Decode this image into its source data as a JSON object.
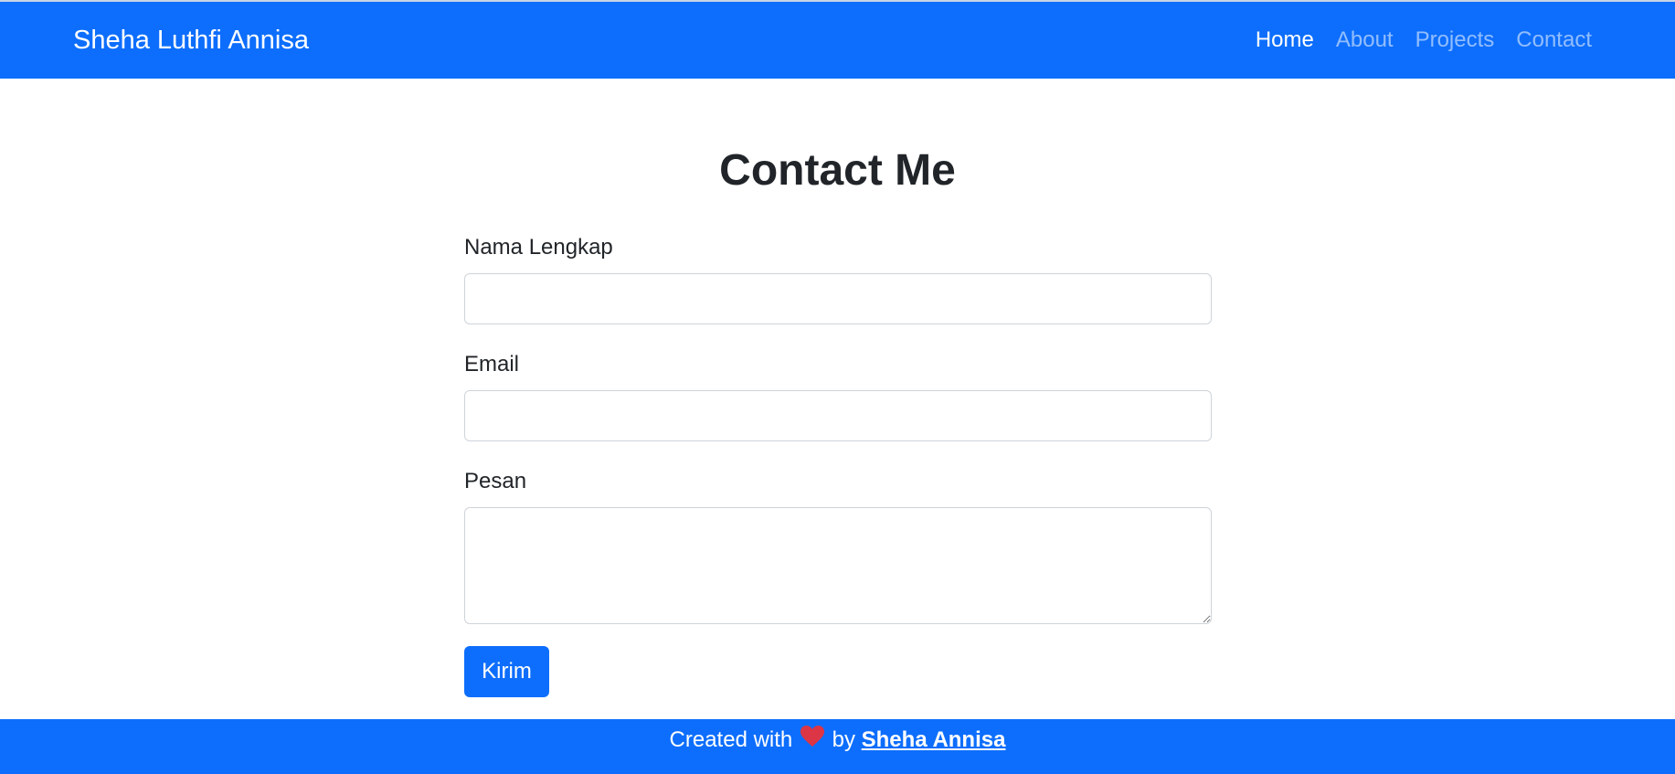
{
  "navbar": {
    "brand": "Sheha Luthfi Annisa",
    "links": [
      {
        "label": "Home",
        "active": true
      },
      {
        "label": "About",
        "active": false
      },
      {
        "label": "Projects",
        "active": false
      },
      {
        "label": "Contact",
        "active": false
      }
    ]
  },
  "main": {
    "title": "Contact Me",
    "form": {
      "name_label": "Nama Lengkap",
      "name_value": "",
      "email_label": "Email",
      "email_value": "",
      "message_label": "Pesan",
      "message_value": "",
      "submit_label": "Kirim"
    }
  },
  "footer": {
    "prefix": "Created with",
    "heart_icon": "heart-icon",
    "by": "by",
    "author": "Sheha Annisa"
  },
  "colors": {
    "primary": "#0d6efd",
    "heart": "#dc3545",
    "text": "#212529"
  }
}
